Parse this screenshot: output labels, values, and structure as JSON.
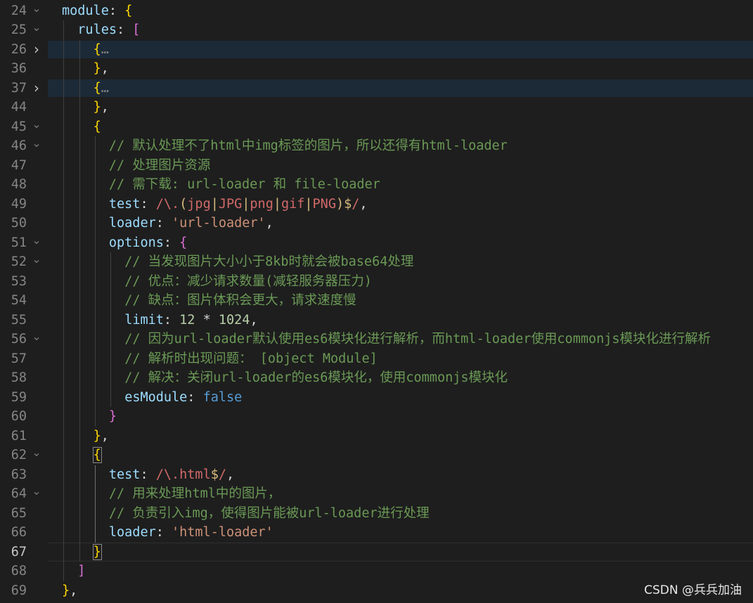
{
  "editor": {
    "lines": [
      {
        "num": "24",
        "fold": "open",
        "hl": false,
        "current": false,
        "indent": 0,
        "tokens": [
          {
            "t": "module",
            "c": "k"
          },
          {
            "t": ": ",
            "c": "p"
          },
          {
            "t": "{",
            "c": "b1"
          }
        ]
      },
      {
        "num": "25",
        "fold": "open",
        "hl": false,
        "current": false,
        "indent": 1,
        "tokens": [
          {
            "t": "rules",
            "c": "k"
          },
          {
            "t": ": ",
            "c": "p"
          },
          {
            "t": "[",
            "c": "b2"
          }
        ]
      },
      {
        "num": "26",
        "fold": "closed",
        "hl": true,
        "current": false,
        "indent": 2,
        "tokens": [
          {
            "t": "{",
            "c": "b1"
          },
          {
            "t": "…",
            "c": "dots"
          }
        ]
      },
      {
        "num": "36",
        "fold": "",
        "hl": false,
        "current": false,
        "indent": 2,
        "tokens": [
          {
            "t": "}",
            "c": "b1"
          },
          {
            "t": ",",
            "c": "p"
          }
        ]
      },
      {
        "num": "37",
        "fold": "closed",
        "hl": true,
        "current": false,
        "indent": 2,
        "tokens": [
          {
            "t": "{",
            "c": "b1"
          },
          {
            "t": "…",
            "c": "dots"
          }
        ]
      },
      {
        "num": "44",
        "fold": "",
        "hl": false,
        "current": false,
        "indent": 2,
        "tokens": [
          {
            "t": "}",
            "c": "b1"
          },
          {
            "t": ",",
            "c": "p"
          }
        ]
      },
      {
        "num": "45",
        "fold": "open",
        "hl": false,
        "current": false,
        "indent": 2,
        "tokens": [
          {
            "t": "{",
            "c": "b1"
          }
        ]
      },
      {
        "num": "46",
        "fold": "open",
        "hl": false,
        "current": false,
        "indent": 3,
        "tokens": [
          {
            "t": "// 默认处理不了html中img标签的图片，所以还得有html-loader",
            "c": "c"
          }
        ]
      },
      {
        "num": "47",
        "fold": "",
        "hl": false,
        "current": false,
        "indent": 3,
        "tokens": [
          {
            "t": "// 处理图片资源",
            "c": "c"
          }
        ]
      },
      {
        "num": "48",
        "fold": "",
        "hl": false,
        "current": false,
        "indent": 3,
        "tokens": [
          {
            "t": "// 需下载: url-loader 和 file-loader",
            "c": "c"
          }
        ]
      },
      {
        "num": "49",
        "fold": "",
        "hl": false,
        "current": false,
        "indent": 3,
        "tokens": [
          {
            "t": "test",
            "c": "k"
          },
          {
            "t": ": ",
            "c": "p"
          },
          {
            "t": "/\\.",
            "c": "r"
          },
          {
            "t": "(",
            "c": "re"
          },
          {
            "t": "jpg",
            "c": "r"
          },
          {
            "t": "|",
            "c": "re"
          },
          {
            "t": "JPG",
            "c": "r"
          },
          {
            "t": "|",
            "c": "re"
          },
          {
            "t": "png",
            "c": "r"
          },
          {
            "t": "|",
            "c": "re"
          },
          {
            "t": "gif",
            "c": "r"
          },
          {
            "t": "|",
            "c": "re"
          },
          {
            "t": "PNG",
            "c": "r"
          },
          {
            "t": ")",
            "c": "re"
          },
          {
            "t": "$",
            "c": "re"
          },
          {
            "t": "/",
            "c": "r"
          },
          {
            "t": ",",
            "c": "p"
          }
        ]
      },
      {
        "num": "50",
        "fold": "",
        "hl": false,
        "current": false,
        "indent": 3,
        "tokens": [
          {
            "t": "loader",
            "c": "k"
          },
          {
            "t": ": ",
            "c": "p"
          },
          {
            "t": "'url-loader'",
            "c": "s"
          },
          {
            "t": ",",
            "c": "p"
          }
        ]
      },
      {
        "num": "51",
        "fold": "open",
        "hl": false,
        "current": false,
        "indent": 3,
        "tokens": [
          {
            "t": "options",
            "c": "k"
          },
          {
            "t": ": ",
            "c": "p"
          },
          {
            "t": "{",
            "c": "b2"
          }
        ]
      },
      {
        "num": "52",
        "fold": "open",
        "hl": false,
        "current": false,
        "indent": 4,
        "tokens": [
          {
            "t": "// 当发现图片大小小于8kb时就会被base64处理",
            "c": "c"
          }
        ]
      },
      {
        "num": "53",
        "fold": "",
        "hl": false,
        "current": false,
        "indent": 4,
        "tokens": [
          {
            "t": "// 优点：减少请求数量(减轻服务器压力)",
            "c": "c"
          }
        ]
      },
      {
        "num": "54",
        "fold": "",
        "hl": false,
        "current": false,
        "indent": 4,
        "tokens": [
          {
            "t": "// 缺点：图片体积会更大，请求速度慢",
            "c": "c"
          }
        ]
      },
      {
        "num": "55",
        "fold": "",
        "hl": false,
        "current": false,
        "indent": 4,
        "tokens": [
          {
            "t": "limit",
            "c": "k"
          },
          {
            "t": ": ",
            "c": "p"
          },
          {
            "t": "12",
            "c": "n"
          },
          {
            "t": " * ",
            "c": "p"
          },
          {
            "t": "1024",
            "c": "n"
          },
          {
            "t": ",",
            "c": "p"
          }
        ]
      },
      {
        "num": "56",
        "fold": "open",
        "hl": false,
        "current": false,
        "indent": 4,
        "tokens": [
          {
            "t": "// 因为url-loader默认使用es6模块化进行解析，而html-loader使用commonjs模块化进行解析",
            "c": "c"
          }
        ]
      },
      {
        "num": "57",
        "fold": "",
        "hl": false,
        "current": false,
        "indent": 4,
        "tokens": [
          {
            "t": "// 解析时出现问题： [object Module]",
            "c": "c"
          }
        ]
      },
      {
        "num": "58",
        "fold": "",
        "hl": false,
        "current": false,
        "indent": 4,
        "tokens": [
          {
            "t": "// 解决：关闭url-loader的es6模块化，使用commonjs模块化",
            "c": "c"
          }
        ]
      },
      {
        "num": "59",
        "fold": "",
        "hl": false,
        "current": false,
        "indent": 4,
        "tokens": [
          {
            "t": "esModule",
            "c": "k"
          },
          {
            "t": ": ",
            "c": "p"
          },
          {
            "t": "false",
            "c": "kw"
          }
        ]
      },
      {
        "num": "60",
        "fold": "",
        "hl": false,
        "current": false,
        "indent": 3,
        "tokens": [
          {
            "t": "}",
            "c": "b2"
          }
        ]
      },
      {
        "num": "61",
        "fold": "",
        "hl": false,
        "current": false,
        "indent": 2,
        "tokens": [
          {
            "t": "}",
            "c": "b1"
          },
          {
            "t": ",",
            "c": "p"
          }
        ]
      },
      {
        "num": "62",
        "fold": "open",
        "hl": false,
        "current": false,
        "indent": 2,
        "tokens": [
          {
            "t": "{",
            "c": "b1",
            "box": true
          }
        ]
      },
      {
        "num": "63",
        "fold": "",
        "hl": false,
        "current": false,
        "indent": 3,
        "tokens": [
          {
            "t": "test",
            "c": "k"
          },
          {
            "t": ": ",
            "c": "p"
          },
          {
            "t": "/\\.",
            "c": "r"
          },
          {
            "t": "html",
            "c": "r"
          },
          {
            "t": "$",
            "c": "re"
          },
          {
            "t": "/",
            "c": "r"
          },
          {
            "t": ",",
            "c": "p"
          }
        ]
      },
      {
        "num": "64",
        "fold": "open",
        "hl": false,
        "current": false,
        "indent": 3,
        "tokens": [
          {
            "t": "// 用来处理html中的图片，",
            "c": "c"
          }
        ]
      },
      {
        "num": "65",
        "fold": "",
        "hl": false,
        "current": false,
        "indent": 3,
        "tokens": [
          {
            "t": "// 负责引入img，使得图片能被url-loader进行处理",
            "c": "c"
          }
        ]
      },
      {
        "num": "66",
        "fold": "",
        "hl": false,
        "current": false,
        "indent": 3,
        "tokens": [
          {
            "t": "loader",
            "c": "k"
          },
          {
            "t": ": ",
            "c": "p"
          },
          {
            "t": "'html-loader'",
            "c": "s"
          }
        ]
      },
      {
        "num": "67",
        "fold": "",
        "hl": false,
        "current": true,
        "indent": 2,
        "tokens": [
          {
            "t": "}",
            "c": "b1",
            "box": true
          }
        ]
      },
      {
        "num": "68",
        "fold": "",
        "hl": false,
        "current": false,
        "indent": 1,
        "tokens": [
          {
            "t": "]",
            "c": "b2"
          }
        ]
      },
      {
        "num": "69",
        "fold": "",
        "hl": false,
        "current": false,
        "indent": 0,
        "tokens": [
          {
            "t": "}",
            "c": "b1"
          },
          {
            "t": ",",
            "c": "p"
          }
        ]
      }
    ]
  },
  "watermark": "CSDN @兵兵加油"
}
